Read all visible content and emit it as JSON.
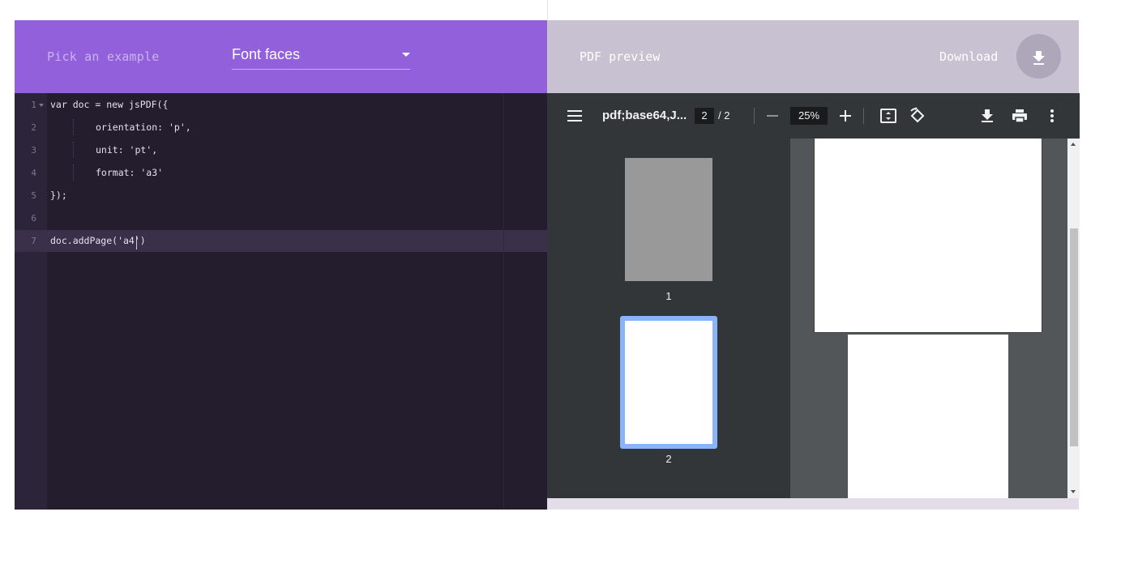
{
  "header": {
    "pick_label": "Pick an example",
    "example_selected": "Font faces",
    "preview_label": "PDF preview",
    "download_label": "Download"
  },
  "editor": {
    "lines": [
      {
        "num": "1",
        "text": "var doc = new jsPDF({"
      },
      {
        "num": "2",
        "text": "orientation: 'p',"
      },
      {
        "num": "3",
        "text": "unit: 'pt',"
      },
      {
        "num": "4",
        "text": "format: 'a3'"
      },
      {
        "num": "5",
        "text": "});"
      },
      {
        "num": "6",
        "text": ""
      },
      {
        "num": "7",
        "text": "doc.addPage('a4')"
      }
    ]
  },
  "pdf_viewer": {
    "title": "pdf;base64,J...",
    "current_page": "2",
    "page_total": "/  2",
    "zoom": "25%",
    "thumbnails": [
      "1",
      "2"
    ]
  },
  "colors": {
    "left_header": "#9360db",
    "right_header": "#c8c1d2",
    "editor_bg": "#231d2e",
    "viewer_toolbar": "#323639",
    "selected_thumb": "#8ab4f8"
  },
  "icons": {
    "menu": "menu-icon",
    "zoom_out": "minus-icon",
    "zoom_in": "plus-icon",
    "fit": "fit-page-icon",
    "rotate": "rotate-icon",
    "download": "download-icon",
    "print": "print-icon",
    "more": "more-vert-icon"
  }
}
